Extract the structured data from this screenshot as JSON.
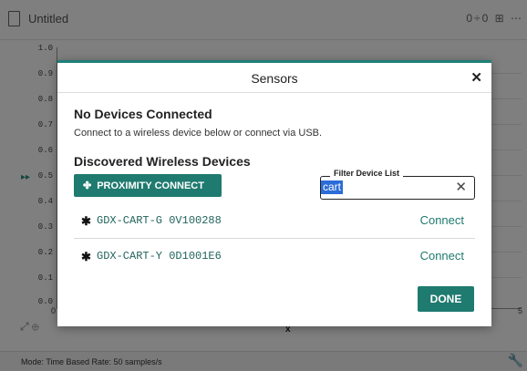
{
  "app": {
    "doc_title": "Untitled",
    "title_tools": "0÷0 ⊞ ⋯",
    "y_ticks": [
      "1.0",
      "0.9",
      "0.8",
      "0.7",
      "0.6",
      "0.5",
      "0.4",
      "0.3",
      "0.2",
      "0.1",
      "0.0"
    ],
    "x_zero": "0",
    "x_end": "5",
    "x_axis_label": "x",
    "status_text": "Mode: Time Based    Rate: 50 samples/s"
  },
  "dialog": {
    "title": "Sensors",
    "no_devices_title": "No Devices Connected",
    "no_devices_sub": "Connect to a wireless device below or connect via USB.",
    "discovered_title": "Discovered Wireless Devices",
    "proximity_label": "PROXIMITY CONNECT",
    "filter": {
      "label": "Filter Device List",
      "value": "cart"
    },
    "devices": [
      {
        "name": "GDX-CART-G 0V100288",
        "action": "Connect"
      },
      {
        "name": "GDX-CART-Y 0D1001E6",
        "action": "Connect"
      }
    ],
    "done_label": "DONE"
  },
  "colors": {
    "accent": "#1f7a6f",
    "selection": "#2b6cd8"
  }
}
